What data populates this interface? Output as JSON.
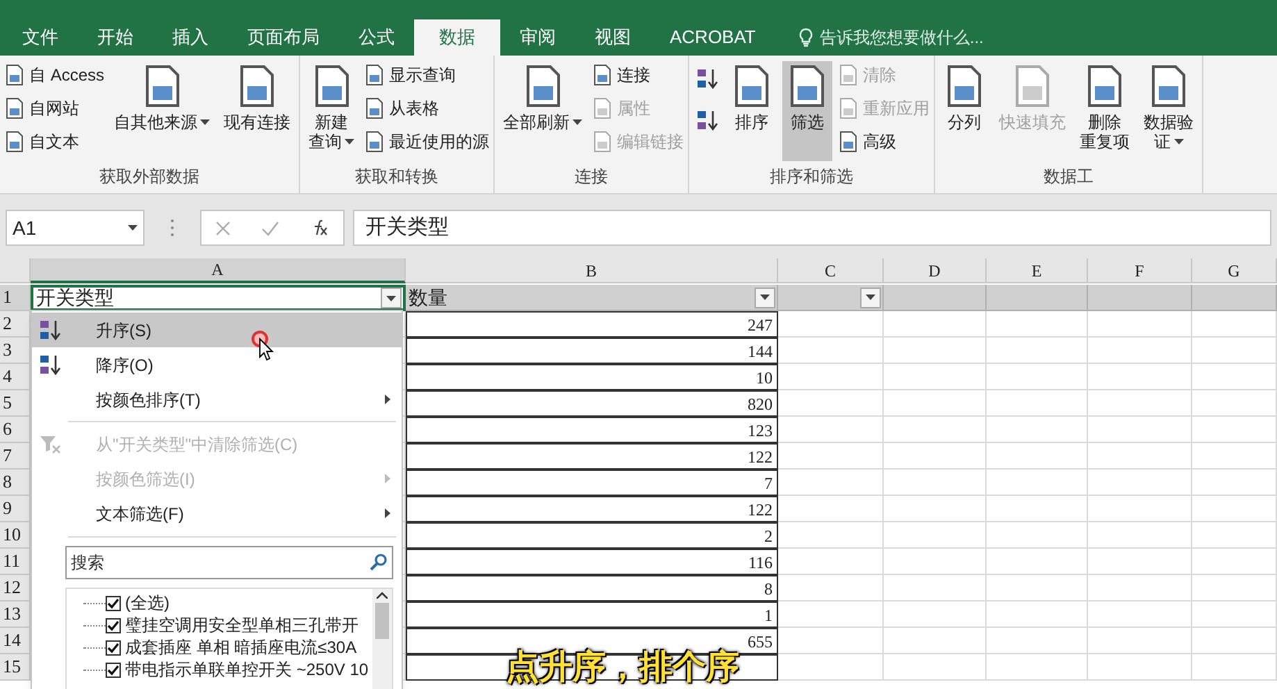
{
  "tabs": [
    {
      "label": "文件",
      "selected": false
    },
    {
      "label": "开始",
      "selected": false
    },
    {
      "label": "插入",
      "selected": false
    },
    {
      "label": "页面布局",
      "selected": false
    },
    {
      "label": "公式",
      "selected": false
    },
    {
      "label": "数据",
      "selected": true
    },
    {
      "label": "审阅",
      "selected": false
    },
    {
      "label": "视图",
      "selected": false
    },
    {
      "label": "ACROBAT",
      "selected": false
    }
  ],
  "tell_me": "告诉我您想要做什么...",
  "ribbon_groups": [
    {
      "label": "获取外部数据",
      "buttons": [
        {
          "kind": "small",
          "label": "自 Access",
          "disabled": false,
          "on": false,
          "dropdown": false
        },
        {
          "kind": "small",
          "label": "自网站",
          "disabled": false,
          "on": false,
          "dropdown": false
        },
        {
          "kind": "small",
          "label": "自文本",
          "disabled": false,
          "on": false,
          "dropdown": false
        },
        {
          "kind": "large",
          "lines": [
            "自其他来源"
          ],
          "disabled": false,
          "on": false,
          "dropdown": true
        },
        {
          "kind": "large",
          "lines": [
            "现有连接"
          ],
          "disabled": false,
          "on": false,
          "dropdown": false
        }
      ]
    },
    {
      "label": "获取和转换",
      "buttons": [
        {
          "kind": "large",
          "lines": [
            "新建",
            "查询"
          ],
          "disabled": false,
          "on": false,
          "dropdown": true
        },
        {
          "kind": "small",
          "label": "显示查询",
          "disabled": false,
          "on": false,
          "dropdown": false
        },
        {
          "kind": "small",
          "label": "从表格",
          "disabled": false,
          "on": false,
          "dropdown": false
        },
        {
          "kind": "small",
          "label": "最近使用的源",
          "disabled": false,
          "on": false,
          "dropdown": false
        }
      ]
    },
    {
      "label": "连接",
      "buttons": [
        {
          "kind": "large",
          "lines": [
            "全部刷新"
          ],
          "disabled": false,
          "on": false,
          "dropdown": true
        },
        {
          "kind": "small",
          "label": "连接",
          "disabled": false,
          "on": false,
          "dropdown": false
        },
        {
          "kind": "small",
          "label": "属性",
          "disabled": true,
          "on": false,
          "dropdown": false
        },
        {
          "kind": "small",
          "label": "编辑链接",
          "disabled": true,
          "on": false,
          "dropdown": false
        }
      ]
    },
    {
      "label": "排序和筛选",
      "buttons": [
        {
          "kind": "sort_asc",
          "disabled": false,
          "on": false
        },
        {
          "kind": "sort_desc",
          "disabled": false,
          "on": false
        },
        {
          "kind": "large",
          "lines": [
            "排序"
          ],
          "disabled": false,
          "on": false,
          "dropdown": false
        },
        {
          "kind": "large",
          "lines": [
            "筛选"
          ],
          "disabled": false,
          "on": true,
          "dropdown": false
        },
        {
          "kind": "small",
          "label": "清除",
          "disabled": true,
          "on": false,
          "dropdown": false
        },
        {
          "kind": "small",
          "label": "重新应用",
          "disabled": true,
          "on": false,
          "dropdown": false
        },
        {
          "kind": "small",
          "label": "高级",
          "disabled": false,
          "on": false,
          "dropdown": false
        }
      ]
    },
    {
      "label": "数据工",
      "buttons": [
        {
          "kind": "large",
          "lines": [
            "分列"
          ],
          "disabled": false,
          "on": false,
          "dropdown": false
        },
        {
          "kind": "large",
          "lines": [
            "快速填充"
          ],
          "disabled": true,
          "on": false,
          "dropdown": false
        },
        {
          "kind": "large",
          "lines": [
            "删除",
            "重复项"
          ],
          "disabled": false,
          "on": false,
          "dropdown": false
        },
        {
          "kind": "large",
          "lines": [
            "数据验",
            "证"
          ],
          "disabled": false,
          "on": false,
          "dropdown": true
        }
      ]
    }
  ],
  "formula_bar": {
    "name_box": "A1",
    "value": "开关类型"
  },
  "columns": [
    "A",
    "B",
    "C",
    "D",
    "E",
    "F",
    "G"
  ],
  "row_numbers": [
    "1",
    "2",
    "3",
    "4",
    "5",
    "6",
    "7",
    "8",
    "9",
    "10",
    "11",
    "12",
    "13",
    "14",
    "15"
  ],
  "header_cells": [
    {
      "text": "开关类型",
      "selected": true
    },
    {
      "text": "数量",
      "selected": false
    },
    {
      "selected": false
    }
  ],
  "column_b_values": [
    "247",
    "144",
    "10",
    "820",
    "123",
    "122",
    "7",
    "122",
    "2",
    "116",
    "8",
    "1",
    "655"
  ],
  "filter_menu": {
    "items": [
      {
        "kind": "sort_asc",
        "label": "升序(S)",
        "selected": true,
        "disabled": false,
        "submenu": false
      },
      {
        "kind": "sort_desc",
        "label": "降序(O)",
        "selected": false,
        "disabled": false,
        "submenu": false
      },
      {
        "kind": "plain",
        "label": "按颜色排序(T)",
        "selected": false,
        "disabled": false,
        "submenu": true
      },
      {
        "kind": "separator"
      },
      {
        "kind": "clear_filter",
        "label": "从\"开关类型\"中清除筛选(C)",
        "selected": false,
        "disabled": true,
        "submenu": false
      },
      {
        "kind": "plain",
        "label": "按颜色筛选(I)",
        "selected": false,
        "disabled": true,
        "submenu": true
      },
      {
        "kind": "plain",
        "label": "文本筛选(F)",
        "selected": false,
        "disabled": false,
        "submenu": true
      }
    ],
    "search": {
      "placeholder": "搜索"
    },
    "checklist": [
      {
        "label": "(全选)",
        "checked": true
      },
      {
        "label": "璧挂空调用安全型单相三孔带开",
        "checked": true
      },
      {
        "label": "成套插座 单相 暗插座电流≤30A",
        "checked": true
      },
      {
        "label": "带电指示单联单控开关 ~250V 10",
        "checked": true
      }
    ]
  },
  "caption": "点升序，排个序"
}
